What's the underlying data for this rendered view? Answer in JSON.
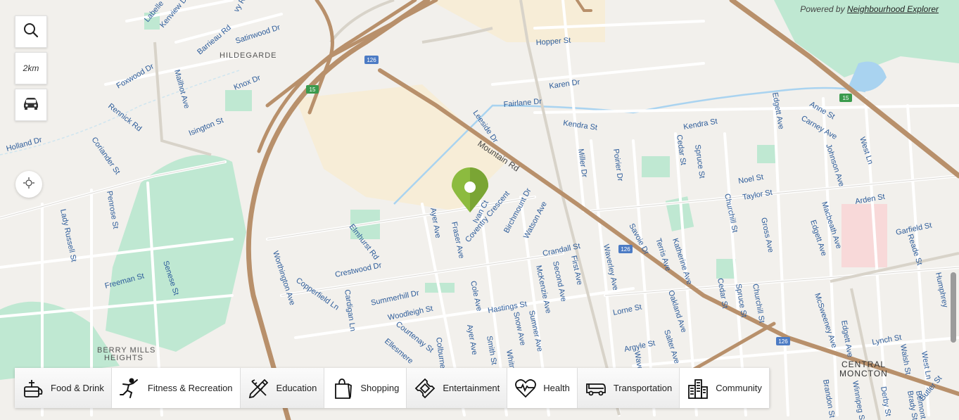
{
  "attribution": {
    "prefix": "Powered by ",
    "link": "Neighbourhood Explorer"
  },
  "controls": {
    "radius_label": "2km"
  },
  "icons": {
    "search": "search-icon",
    "car": "car-icon",
    "recenter": "crosshair-icon",
    "pin": "map-pin-icon"
  },
  "categories": [
    {
      "label": "Food & Drink",
      "icon": "food-icon"
    },
    {
      "label": "Fitness & Recreation",
      "icon": "fitness-icon"
    },
    {
      "label": "Education",
      "icon": "pencil-ruler-icon"
    },
    {
      "label": "Shopping",
      "icon": "shopping-bag-icon"
    },
    {
      "label": "Entertainment",
      "icon": "ticket-icon"
    },
    {
      "label": "Health",
      "icon": "heartbeat-icon"
    },
    {
      "label": "Transportation",
      "icon": "bus-icon"
    },
    {
      "label": "Community",
      "icon": "buildings-icon"
    }
  ],
  "map": {
    "colors": {
      "background": "#f2f0ec",
      "highway": "#b8906b",
      "park": "#bfe8d2",
      "water": "#a9d3f0",
      "pin": "#8cbb3f",
      "street_label": "#2d5c9a"
    },
    "areas": [
      "HILDEGARDE",
      "BERRY MILLS",
      "HEIGHTS",
      "CENTRAL",
      "MONCTON"
    ],
    "shields": [
      "126",
      "15",
      "15",
      "126",
      "126"
    ],
    "streets": [
      "Labelle",
      "Kenview Dr",
      "vy Rd",
      "Barrieau Rd",
      "Satinwood Dr",
      "Foxwood Dr",
      "Mailhot Ave",
      "Knox Dr",
      "Rennick Rd",
      "Isington St",
      "Holland Dr",
      "Coriander St",
      "Penrose St",
      "Lady Russell St",
      "Freeman St",
      "Senese St",
      "Worthington Ave",
      "Copperfield Ln",
      "Cardigan Ln",
      "Crestwood Dr",
      "Elmhurst Rd",
      "Summerhill Dr",
      "Woodleigh St",
      "Courtenay St",
      "Ellesmere",
      "Colburne",
      "Ayer Ave",
      "Ayer Ave",
      "Fraser Ave",
      "Ivan Ct",
      "Coventry Crescent",
      "Birchmount Dr",
      "Watson Ave",
      "Mountain Rd",
      "Leeside Dr",
      "Fairlane Dr",
      "Karen Dr",
      "Hopper St",
      "Kendra St",
      "Kendra St",
      "Miller Dr",
      "Poirier Dr",
      "Cedar St",
      "Spruce St",
      "Cole Ave",
      "Hastings St",
      "Snow Ave",
      "Sumner Ave",
      "McKenzie Ave",
      "Second Ave",
      "First Ave",
      "Crandall St",
      "Waverley Ave",
      "Savoie Dr",
      "Terris Ave",
      "Katherine Ave",
      "Churchill St",
      "Gross Ave",
      "Taylor St",
      "Noel St",
      "Edgett Ave",
      "Anne St",
      "Carney Ave",
      "Johnson Ave",
      "West Ln",
      "Arden St",
      "Macbeath Ave",
      "Edgett Ave",
      "Garfield St",
      "Reade St",
      "Lorne St",
      "Oakland Ave",
      "Cedar St",
      "Spruce St",
      "Churchill St",
      "Argyle St",
      "Salter Ave",
      "McSweeney Ave",
      "Edgett Ave",
      "Lynch St",
      "Walsh St",
      "West Ln",
      "Humphrey",
      "Brandon St",
      "Winnipeg St",
      "Derby St",
      "Brady St",
      "Belmont St",
      "Butler St",
      "Smith St",
      "Whitne",
      "Wave"
    ]
  }
}
